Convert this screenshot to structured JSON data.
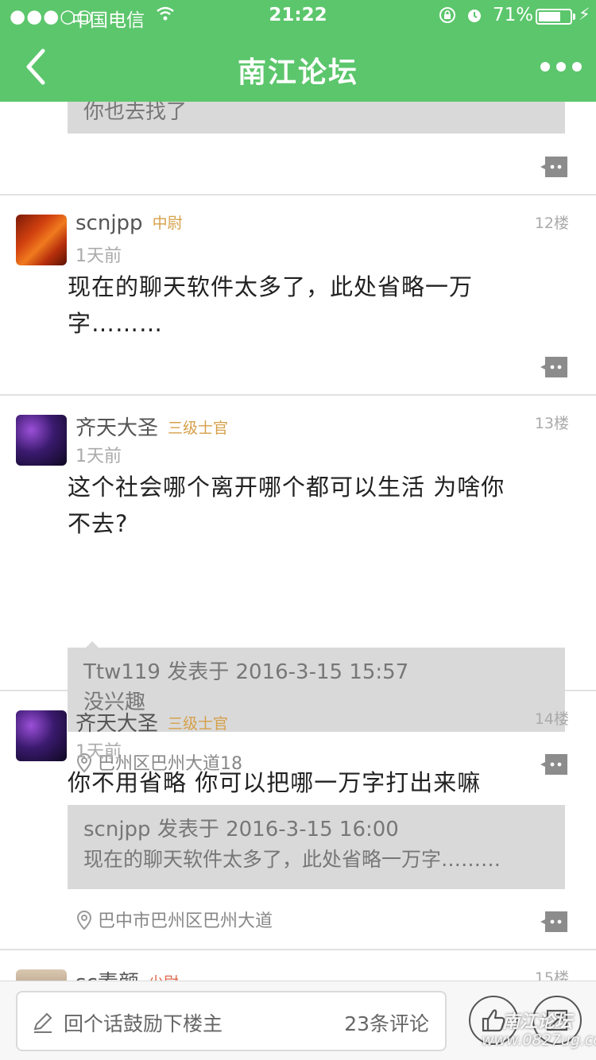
{
  "status_bar": {
    "signal": "●●●○○",
    "carrier": "中国电信",
    "time": "21:22",
    "battery_pct": "71%",
    "battery_level": 0.71
  },
  "nav": {
    "title": "南江论坛",
    "back_icon": "chevron-left-icon",
    "more_icon": "more-dots-icon"
  },
  "partial_top": {
    "quote_text": "你也去找了"
  },
  "posts": [
    {
      "username": "scnjpp",
      "rank": "中尉",
      "time": "1天前",
      "floor": "12楼",
      "text_line1": "现在的聊天软件太多了，此处省略一万",
      "text_line2": "字………"
    },
    {
      "username": "齐天大圣",
      "rank": "三级士官",
      "time": "1天前",
      "floor": "13楼",
      "text_line1": "这个社会哪个离开哪个都可以生活 为啥你",
      "text_line2": "不去?",
      "quote_meta": "Ttw119 发表于 2016-3-15 15:57",
      "quote_text": "没兴趣",
      "location": "巴州区巴州大道18"
    },
    {
      "username": "齐天大圣",
      "rank": "三级士官",
      "time": "1天前",
      "floor": "14楼",
      "text_line1": "你不用省略 你可以把哪一万字打出来嘛",
      "quote_meta": "scnjpp 发表于 2016-3-15 16:00",
      "quote_text": "现在的聊天软件太多了，此处省略一万字………",
      "location": "巴中市巴州区巴州大道"
    },
    {
      "username": "sc素颜",
      "rank": "少尉",
      "floor": "15楼"
    }
  ],
  "bottom_bar": {
    "reply_placeholder": "回个话鼓励下楼主",
    "comment_count": "23条评论",
    "like_icon": "thumbs-up-icon",
    "expand_icon": "expand-icon"
  },
  "watermark": {
    "line1": "南江论坛",
    "line2": "www.0827ug.com"
  },
  "colors": {
    "brand_green": "#5cc66c",
    "rank_gold": "#d6a04a",
    "quote_bg": "#d9d9d9"
  }
}
